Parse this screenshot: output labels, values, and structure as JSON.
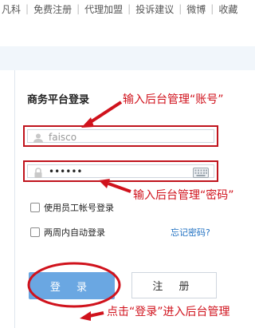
{
  "topnav": {
    "items": [
      "凡科",
      "免费注册",
      "代理加盟",
      "投诉建议",
      "微博",
      "收藏"
    ]
  },
  "login": {
    "title": "商务平台登录",
    "username_value": "faisco",
    "password_masked": "••••••",
    "employee_checkbox_label": "使用员工帐号登录",
    "auto_login_label": "两周内自动登录",
    "forgot_label": "忘记密码?",
    "login_button": "登 录",
    "register_button": "注 册"
  },
  "annotations": {
    "account": "输入后台管理“账号”",
    "password": "输入后台管理“密码”",
    "login": "点击“登录”进入后台管理"
  },
  "colors": {
    "annotation_red": "#d0121c",
    "login_blue": "#6aa7e2",
    "link_blue": "#1e6fc1"
  }
}
